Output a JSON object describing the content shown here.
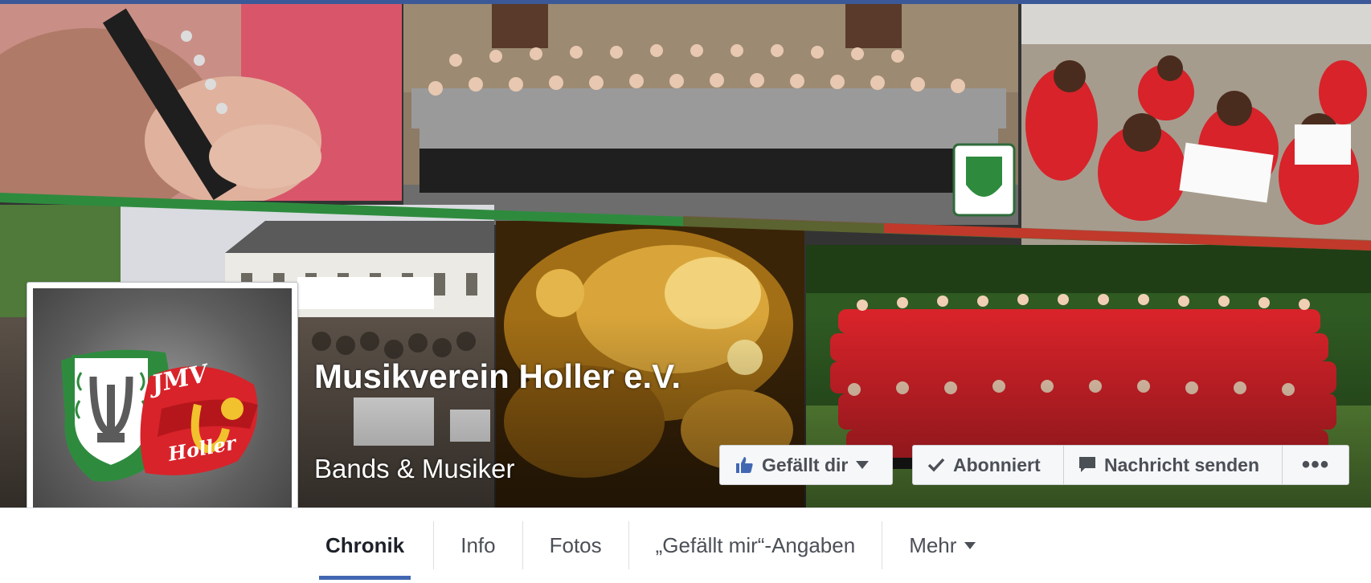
{
  "page": {
    "name": "Musikverein Holler e.V.",
    "category": "Bands & Musiker"
  },
  "actions": {
    "like_label": "Gefällt dir",
    "subscribe_label": "Abonniert",
    "message_label": "Nachricht senden",
    "more_label": "•••"
  },
  "profile": {
    "logo_text": "JMV Holler"
  },
  "tabs": [
    {
      "label": "Chronik",
      "active": true
    },
    {
      "label": "Info",
      "active": false
    },
    {
      "label": "Fotos",
      "active": false
    },
    {
      "label": "„Gefällt mir“-Angaben",
      "active": false
    },
    {
      "label": "Mehr",
      "active": false
    }
  ],
  "colors": {
    "facebook_blue": "#3b5998",
    "active_tab": "#4267b2",
    "stripe_green": "#2e8b3e",
    "stripe_red": "#c0392b",
    "shirt_red": "#d8232a"
  },
  "icons": [
    "thumbs-up-icon",
    "chevron-down-icon",
    "checkmark-icon",
    "speech-bubble-icon",
    "more-icon"
  ]
}
